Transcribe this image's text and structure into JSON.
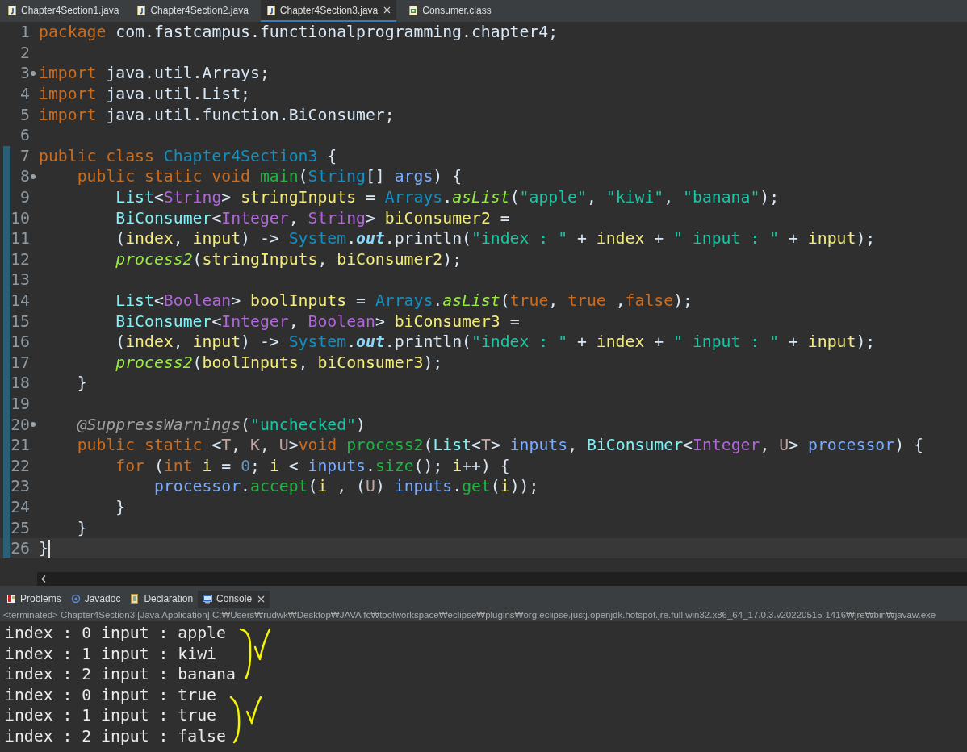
{
  "editor_tabs": [
    {
      "label": "Chapter4Section1.java",
      "kind": "java",
      "selected": false,
      "closable": false
    },
    {
      "label": "Chapter4Section2.java",
      "kind": "java",
      "selected": false,
      "closable": false
    },
    {
      "label": "Chapter4Section3.java",
      "kind": "java",
      "selected": true,
      "closable": true
    },
    {
      "label": "Consumer.class",
      "kind": "class",
      "selected": false,
      "closable": false
    }
  ],
  "code_lines": [
    {
      "number": "1",
      "fold": false,
      "range": false,
      "current": false,
      "tokens": [
        {
          "kind": "kw",
          "text": "package"
        },
        {
          "kind": "p",
          "text": " com.fastcampus.functionalprogramming.chapter4;"
        }
      ]
    },
    {
      "number": "2",
      "fold": false,
      "range": false,
      "current": false
    },
    {
      "number": "3",
      "fold": true,
      "range": false,
      "current": false,
      "tokens": [
        {
          "kind": "kw",
          "text": "import"
        },
        {
          "kind": "p",
          "text": " java.util.Arrays;"
        }
      ]
    },
    {
      "number": "4",
      "fold": false,
      "range": false,
      "current": false,
      "tokens": [
        {
          "kind": "kw",
          "text": "import"
        },
        {
          "kind": "p",
          "text": " java.util.List;"
        }
      ]
    },
    {
      "number": "5",
      "fold": false,
      "range": false,
      "current": false,
      "tokens": [
        {
          "kind": "kw",
          "text": "import"
        },
        {
          "kind": "p",
          "text": " java.util.function.BiConsumer;"
        }
      ]
    },
    {
      "number": "6",
      "fold": false,
      "range": false,
      "current": false
    },
    {
      "number": "7",
      "fold": false,
      "range": true,
      "current": false,
      "tokens": [
        {
          "kind": "kw",
          "text": "public class "
        },
        {
          "kind": "cls",
          "text": "Chapter4Section3"
        },
        {
          "kind": "p",
          "text": " {"
        }
      ]
    },
    {
      "number": "8",
      "fold": true,
      "range": true,
      "current": false,
      "tokens": [
        {
          "kind": "kw",
          "text": "    public static void "
        },
        {
          "kind": "m",
          "text": "main"
        },
        {
          "kind": "p",
          "text": "("
        },
        {
          "kind": "cls",
          "text": "String"
        },
        {
          "kind": "p",
          "text": "[] "
        },
        {
          "kind": "par",
          "text": "args"
        },
        {
          "kind": "p",
          "text": ") {"
        }
      ]
    },
    {
      "number": "9",
      "fold": false,
      "range": true,
      "current": false,
      "tokens": [
        {
          "kind": "itf",
          "text": "        List"
        },
        {
          "kind": "p",
          "text": "<"
        },
        {
          "kind": "tp",
          "text": "String"
        },
        {
          "kind": "p",
          "text": "> "
        },
        {
          "kind": "loc",
          "text": "stringInputs"
        },
        {
          "kind": "p",
          "text": " = "
        },
        {
          "kind": "cls",
          "text": "Arrays"
        },
        {
          "kind": "p",
          "text": "."
        },
        {
          "kind": "sm",
          "text": "asList"
        },
        {
          "kind": "p",
          "text": "("
        },
        {
          "kind": "str",
          "text": "\"apple\""
        },
        {
          "kind": "p",
          "text": ", "
        },
        {
          "kind": "str",
          "text": "\"kiwi\""
        },
        {
          "kind": "p",
          "text": ", "
        },
        {
          "kind": "str",
          "text": "\"banana\""
        },
        {
          "kind": "p",
          "text": ");"
        }
      ]
    },
    {
      "number": "10",
      "fold": false,
      "range": true,
      "current": false,
      "tokens": [
        {
          "kind": "itf",
          "text": "        BiConsumer"
        },
        {
          "kind": "p",
          "text": "<"
        },
        {
          "kind": "tp",
          "text": "Integer"
        },
        {
          "kind": "p",
          "text": ", "
        },
        {
          "kind": "tp",
          "text": "String"
        },
        {
          "kind": "p",
          "text": "> "
        },
        {
          "kind": "loc",
          "text": "biConsumer2"
        },
        {
          "kind": "p",
          "text": " ="
        }
      ]
    },
    {
      "number": "11",
      "fold": false,
      "range": true,
      "current": false,
      "tokens": [
        {
          "kind": "p",
          "text": "        ("
        },
        {
          "kind": "loc",
          "text": "index"
        },
        {
          "kind": "p",
          "text": ", "
        },
        {
          "kind": "loc",
          "text": "input"
        },
        {
          "kind": "p",
          "text": ") -> "
        },
        {
          "kind": "cls",
          "text": "System"
        },
        {
          "kind": "p",
          "text": "."
        },
        {
          "kind": "sf",
          "text": "out"
        },
        {
          "kind": "p",
          "text": ".println("
        },
        {
          "kind": "str",
          "text": "\"index : \""
        },
        {
          "kind": "p",
          "text": " + "
        },
        {
          "kind": "loc",
          "text": "index"
        },
        {
          "kind": "p",
          "text": " + "
        },
        {
          "kind": "str",
          "text": "\" input : \""
        },
        {
          "kind": "p",
          "text": " + "
        },
        {
          "kind": "loc",
          "text": "input"
        },
        {
          "kind": "p",
          "text": ");"
        }
      ]
    },
    {
      "number": "12",
      "fold": false,
      "range": true,
      "current": false,
      "tokens": [
        {
          "kind": "sm",
          "text": "        process2"
        },
        {
          "kind": "p",
          "text": "("
        },
        {
          "kind": "loc",
          "text": "stringInputs"
        },
        {
          "kind": "p",
          "text": ", "
        },
        {
          "kind": "loc",
          "text": "biConsumer2"
        },
        {
          "kind": "p",
          "text": ");"
        }
      ]
    },
    {
      "number": "13",
      "fold": false,
      "range": true,
      "current": false
    },
    {
      "number": "14",
      "fold": false,
      "range": true,
      "current": false,
      "tokens": [
        {
          "kind": "itf",
          "text": "        List"
        },
        {
          "kind": "p",
          "text": "<"
        },
        {
          "kind": "tp",
          "text": "Boolean"
        },
        {
          "kind": "p",
          "text": "> "
        },
        {
          "kind": "loc",
          "text": "boolInputs"
        },
        {
          "kind": "p",
          "text": " = "
        },
        {
          "kind": "cls",
          "text": "Arrays"
        },
        {
          "kind": "p",
          "text": "."
        },
        {
          "kind": "sm",
          "text": "asList"
        },
        {
          "kind": "p",
          "text": "("
        },
        {
          "kind": "kw",
          "text": "true"
        },
        {
          "kind": "p",
          "text": ", "
        },
        {
          "kind": "kw",
          "text": "true"
        },
        {
          "kind": "p",
          "text": " ,"
        },
        {
          "kind": "kw",
          "text": "false"
        },
        {
          "kind": "p",
          "text": ");"
        }
      ]
    },
    {
      "number": "15",
      "fold": false,
      "range": true,
      "current": false,
      "tokens": [
        {
          "kind": "itf",
          "text": "        BiConsumer"
        },
        {
          "kind": "p",
          "text": "<"
        },
        {
          "kind": "tp",
          "text": "Integer"
        },
        {
          "kind": "p",
          "text": ", "
        },
        {
          "kind": "tp",
          "text": "Boolean"
        },
        {
          "kind": "p",
          "text": "> "
        },
        {
          "kind": "loc",
          "text": "biConsumer3"
        },
        {
          "kind": "p",
          "text": " ="
        }
      ]
    },
    {
      "number": "16",
      "fold": false,
      "range": true,
      "current": false,
      "tokens": [
        {
          "kind": "p",
          "text": "        ("
        },
        {
          "kind": "loc",
          "text": "index"
        },
        {
          "kind": "p",
          "text": ", "
        },
        {
          "kind": "loc",
          "text": "input"
        },
        {
          "kind": "p",
          "text": ") -> "
        },
        {
          "kind": "cls",
          "text": "System"
        },
        {
          "kind": "p",
          "text": "."
        },
        {
          "kind": "sf",
          "text": "out"
        },
        {
          "kind": "p",
          "text": ".println("
        },
        {
          "kind": "str",
          "text": "\"index : \""
        },
        {
          "kind": "p",
          "text": " + "
        },
        {
          "kind": "loc",
          "text": "index"
        },
        {
          "kind": "p",
          "text": " + "
        },
        {
          "kind": "str",
          "text": "\" input : \""
        },
        {
          "kind": "p",
          "text": " + "
        },
        {
          "kind": "loc",
          "text": "input"
        },
        {
          "kind": "p",
          "text": ");"
        }
      ]
    },
    {
      "number": "17",
      "fold": false,
      "range": true,
      "current": false,
      "tokens": [
        {
          "kind": "sm",
          "text": "        process2"
        },
        {
          "kind": "p",
          "text": "("
        },
        {
          "kind": "loc",
          "text": "boolInputs"
        },
        {
          "kind": "p",
          "text": ", "
        },
        {
          "kind": "loc",
          "text": "biConsumer3"
        },
        {
          "kind": "p",
          "text": ");"
        }
      ]
    },
    {
      "number": "18",
      "fold": false,
      "range": true,
      "current": false,
      "tokens": [
        {
          "kind": "p",
          "text": "    }"
        }
      ]
    },
    {
      "number": "19",
      "fold": false,
      "range": true,
      "current": false
    },
    {
      "number": "20",
      "fold": true,
      "range": true,
      "current": false,
      "tokens": [
        {
          "kind": "ann",
          "text": "    @SuppressWarnings"
        },
        {
          "kind": "p",
          "text": "("
        },
        {
          "kind": "str",
          "text": "\"unchecked\""
        },
        {
          "kind": "p",
          "text": ")"
        }
      ]
    },
    {
      "number": "21",
      "fold": false,
      "range": true,
      "current": false,
      "tokens": [
        {
          "kind": "kw",
          "text": "    public static "
        },
        {
          "kind": "p",
          "text": "<"
        },
        {
          "kind": "tv",
          "text": "T"
        },
        {
          "kind": "p",
          "text": ", "
        },
        {
          "kind": "tv",
          "text": "K"
        },
        {
          "kind": "p",
          "text": ", "
        },
        {
          "kind": "tv",
          "text": "U"
        },
        {
          "kind": "p",
          "text": ">"
        },
        {
          "kind": "kw",
          "text": "void "
        },
        {
          "kind": "m",
          "text": "process2"
        },
        {
          "kind": "p",
          "text": "("
        },
        {
          "kind": "itf",
          "text": "List"
        },
        {
          "kind": "p",
          "text": "<"
        },
        {
          "kind": "tv",
          "text": "T"
        },
        {
          "kind": "p",
          "text": "> "
        },
        {
          "kind": "par",
          "text": "inputs"
        },
        {
          "kind": "p",
          "text": ", "
        },
        {
          "kind": "itf",
          "text": "BiConsumer"
        },
        {
          "kind": "p",
          "text": "<"
        },
        {
          "kind": "tp",
          "text": "Integer"
        },
        {
          "kind": "p",
          "text": ", "
        },
        {
          "kind": "tv",
          "text": "U"
        },
        {
          "kind": "p",
          "text": "> "
        },
        {
          "kind": "par",
          "text": "processor"
        },
        {
          "kind": "p",
          "text": ") {"
        }
      ]
    },
    {
      "number": "22",
      "fold": false,
      "range": true,
      "current": false,
      "tokens": [
        {
          "kind": "kw",
          "text": "        for"
        },
        {
          "kind": "p",
          "text": " ("
        },
        {
          "kind": "kw",
          "text": "int "
        },
        {
          "kind": "loc",
          "text": "i"
        },
        {
          "kind": "p",
          "text": " = "
        },
        {
          "kind": "num",
          "text": "0"
        },
        {
          "kind": "p",
          "text": "; "
        },
        {
          "kind": "loc",
          "text": "i"
        },
        {
          "kind": "p",
          "text": " < "
        },
        {
          "kind": "par",
          "text": "inputs"
        },
        {
          "kind": "p",
          "text": "."
        },
        {
          "kind": "m",
          "text": "size"
        },
        {
          "kind": "p",
          "text": "(); "
        },
        {
          "kind": "loc",
          "text": "i"
        },
        {
          "kind": "p",
          "text": "++) {"
        }
      ]
    },
    {
      "number": "23",
      "fold": false,
      "range": true,
      "current": false,
      "tokens": [
        {
          "kind": "par",
          "text": "            processor"
        },
        {
          "kind": "p",
          "text": "."
        },
        {
          "kind": "m",
          "text": "accept"
        },
        {
          "kind": "p",
          "text": "("
        },
        {
          "kind": "loc",
          "text": "i"
        },
        {
          "kind": "p",
          "text": " , ("
        },
        {
          "kind": "tv",
          "text": "U"
        },
        {
          "kind": "p",
          "text": ") "
        },
        {
          "kind": "par",
          "text": "inputs"
        },
        {
          "kind": "p",
          "text": "."
        },
        {
          "kind": "m",
          "text": "get"
        },
        {
          "kind": "p",
          "text": "("
        },
        {
          "kind": "loc",
          "text": "i"
        },
        {
          "kind": "p",
          "text": "));"
        }
      ]
    },
    {
      "number": "24",
      "fold": false,
      "range": true,
      "current": false,
      "tokens": [
        {
          "kind": "p",
          "text": "        }"
        }
      ]
    },
    {
      "number": "25",
      "fold": false,
      "range": true,
      "current": false,
      "tokens": [
        {
          "kind": "p",
          "text": "    }"
        }
      ]
    },
    {
      "number": "26",
      "fold": false,
      "range": true,
      "current": true,
      "tokens": [
        {
          "kind": "p",
          "text": "}"
        }
      ]
    }
  ],
  "view_tabs": [
    {
      "label": "Problems",
      "kind": "problems",
      "selected": false,
      "closable": false
    },
    {
      "label": "Javadoc",
      "kind": "javadoc",
      "selected": false,
      "closable": false
    },
    {
      "label": "Declaration",
      "kind": "declaration",
      "selected": false,
      "closable": false
    },
    {
      "label": "Console",
      "kind": "console",
      "selected": true,
      "closable": true
    }
  ],
  "console": {
    "status": "<terminated> Chapter4Section3 [Java Application] C:₩Users₩rudwk₩Desktop₩JAVA fc₩toolworkspace₩eclipse₩plugins₩org.eclipse.justj.openjdk.hotspot.jre.full.win32.x86_64_17.0.3.v20220515-1416₩jre₩bin₩javaw.exe",
    "output": [
      "index : 0 input : apple",
      "index : 1 input : kiwi",
      "index : 2 input : banana",
      "index : 0 input : true",
      "index : 1 input : true",
      "index : 2 input : false"
    ]
  }
}
